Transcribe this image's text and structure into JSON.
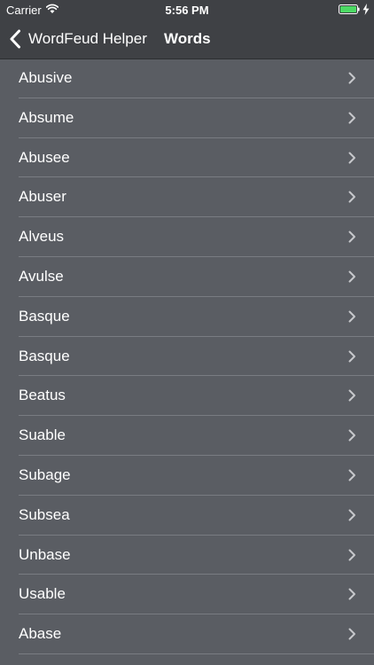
{
  "status_bar": {
    "carrier": "Carrier",
    "time": "5:56 PM",
    "icons": [
      "wifi-icon",
      "battery-icon",
      "charging-icon"
    ],
    "battery_color": "#4cd964"
  },
  "nav_bar": {
    "back_label": "WordFeud Helper",
    "title": "Words",
    "back_icon": "chevron-left-icon"
  },
  "words": [
    {
      "label": "Abusive"
    },
    {
      "label": "Absume"
    },
    {
      "label": "Abusee"
    },
    {
      "label": "Abuser"
    },
    {
      "label": "Alveus"
    },
    {
      "label": "Avulse"
    },
    {
      "label": "Basque"
    },
    {
      "label": "Basque"
    },
    {
      "label": "Beatus"
    },
    {
      "label": "Suable"
    },
    {
      "label": "Subage"
    },
    {
      "label": "Subsea"
    },
    {
      "label": "Unbase"
    },
    {
      "label": "Usable"
    },
    {
      "label": "Abase"
    }
  ],
  "colors": {
    "background": "#5a5d63",
    "bar": "#3f4145",
    "separator": "#797c82",
    "text": "#ffffff"
  }
}
